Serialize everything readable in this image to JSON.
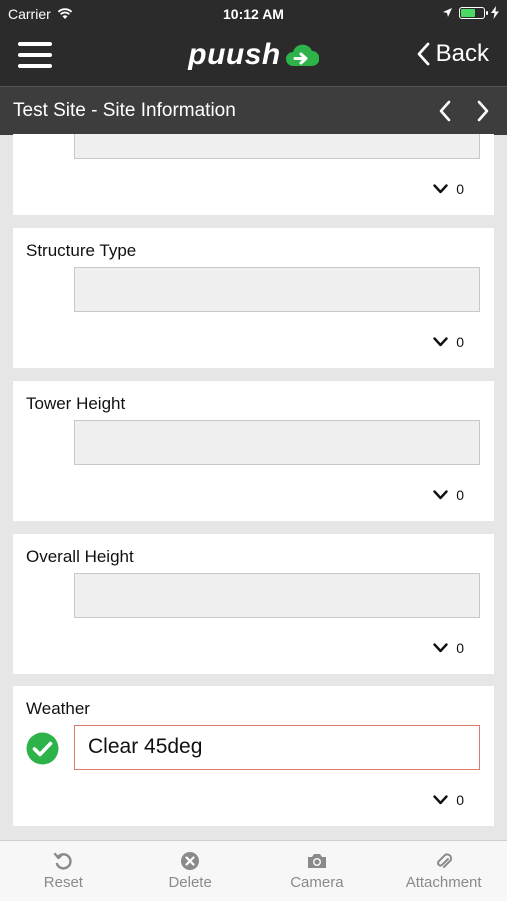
{
  "status_bar": {
    "carrier": "Carrier",
    "time": "10:12 AM"
  },
  "nav": {
    "logo_text": "puush",
    "back_label": "Back"
  },
  "sub_header": {
    "title": "Test Site - Site Information"
  },
  "fields": [
    {
      "label": "",
      "value": "",
      "count": "0",
      "state": "empty"
    },
    {
      "label": "Structure Type",
      "value": "",
      "count": "0",
      "state": "empty"
    },
    {
      "label": "Tower Height",
      "value": "",
      "count": "0",
      "state": "empty"
    },
    {
      "label": "Overall Height",
      "value": "",
      "count": "0",
      "state": "empty"
    },
    {
      "label": "Weather",
      "value": "Clear 45deg",
      "count": "0",
      "state": "valid"
    }
  ],
  "toolbar": {
    "reset": "Reset",
    "delete": "Delete",
    "camera": "Camera",
    "attachment": "Attachment"
  },
  "colors": {
    "nav_bg": "#2b2b2b",
    "accent_green": "#2db34a",
    "error_border": "#e07b6b",
    "toolbar_text": "#8a8a8a"
  }
}
